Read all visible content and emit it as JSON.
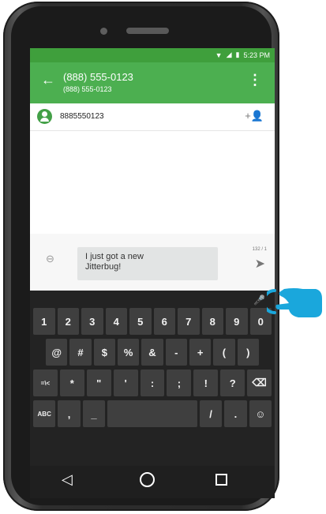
{
  "status_bar": {
    "time": "5:23 PM",
    "icons": [
      "wifi-icon",
      "signal-icon",
      "battery-icon"
    ]
  },
  "app_bar": {
    "title": "(888) 555-0123",
    "subtitle": "(888) 555-0123",
    "back_icon": "←",
    "menu_icon": "⋮"
  },
  "recipient": {
    "number": "8885550123",
    "add_icon": "+👤"
  },
  "compose": {
    "message": "I just got a new Jitterbug!",
    "counter": "132 / 1",
    "attach_icon": "⊖",
    "send_icon": "➤"
  },
  "keyboard": {
    "mic_icon": "🎤",
    "row1": [
      "1",
      "2",
      "3",
      "4",
      "5",
      "6",
      "7",
      "8",
      "9",
      "0"
    ],
    "row2": [
      "@",
      "#",
      "$",
      "%",
      "&",
      "-",
      "+",
      "(",
      ")"
    ],
    "row3": [
      "=\\<",
      "*",
      "\"",
      "'",
      ":",
      ";",
      "!",
      "?",
      "⌫"
    ],
    "row4": [
      "ABC",
      ",",
      "_",
      " ",
      "/",
      ".",
      "☺"
    ]
  },
  "nav": {
    "back": "◁",
    "home": "○",
    "recent": "□"
  },
  "colors": {
    "status_green": "#3f9f3c",
    "appbar_green": "#4caf50",
    "keyboard_bg": "#232323",
    "pointer_cyan": "#1aa7dc"
  }
}
